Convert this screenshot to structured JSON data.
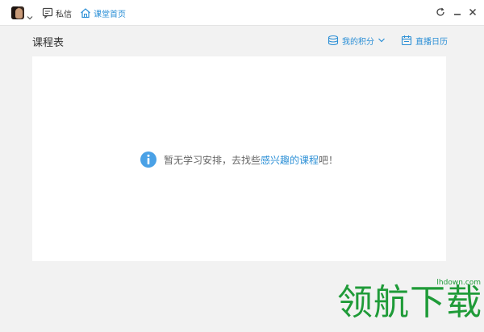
{
  "topbar": {
    "messages_label": "私信",
    "home_label": "课堂首页"
  },
  "page": {
    "title": "课程表",
    "points_label": "我的积分",
    "calendar_label": "直播日历"
  },
  "empty_state": {
    "prefix": "暂无学习安排，去找些",
    "link": "感兴趣的课程",
    "suffix": "吧！"
  },
  "watermark": {
    "text": "领航下载",
    "url": "lhdown.com"
  },
  "colors": {
    "accent": "#2b8fd6",
    "watermark": "#1f9b38"
  }
}
